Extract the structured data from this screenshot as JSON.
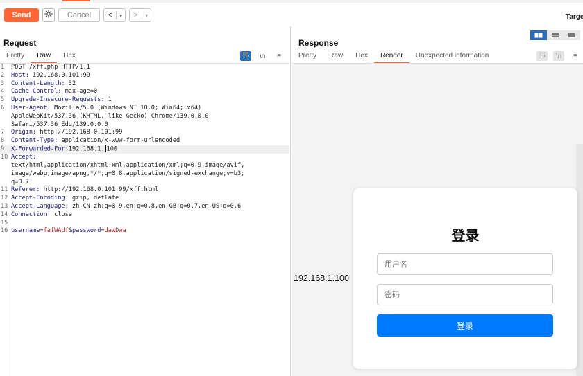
{
  "toolbar": {
    "send_label": "Send",
    "cancel_label": "Cancel",
    "back_arrow": "<",
    "back_dropdown": "▾",
    "forward_arrow": ">",
    "forward_dropdown": "▾",
    "target_label": "Targe",
    "send_color": "#ff6633"
  },
  "request": {
    "title": "Request",
    "tabs": [
      "Pretty",
      "Raw",
      "Hex"
    ],
    "active_tab": "Raw",
    "tool_newline": "\\n",
    "tool_menu": "≡",
    "lines": [
      {
        "n": "1",
        "text": "POST /xff.php HTTP/1.1"
      },
      {
        "n": "2",
        "key": "Host:",
        "val": " 192.168.0.101:99"
      },
      {
        "n": "3",
        "key": "Content-Length:",
        "val": " 32"
      },
      {
        "n": "4",
        "key": "Cache-Control:",
        "val": " max-age=0"
      },
      {
        "n": "5",
        "key": "Upgrade-Insecure-Requests:",
        "val": " 1"
      },
      {
        "n": "6",
        "key": "User-Agent:",
        "val": " Mozilla/5.0 (Windows NT 10.0; Win64; x64)"
      },
      {
        "n": "",
        "text": "AppleWebKit/537.36 (KHTML, like Gecko) Chrome/139.0.0.0"
      },
      {
        "n": "",
        "text": "Safari/537.36 Edg/139.0.0.0"
      },
      {
        "n": "7",
        "key": "Origin:",
        "val": " http://192.168.0.101:99"
      },
      {
        "n": "8",
        "key": "Content-Type:",
        "val": " application/x-www-form-urlencoded"
      },
      {
        "n": "9",
        "key": "X-Forwarded-For:",
        "val": "192.168.1.",
        "val2": "100",
        "caret": true,
        "highlight": true
      },
      {
        "n": "10",
        "key": "Accept:",
        "val": ""
      },
      {
        "n": "",
        "text": "text/html,application/xhtml+xml,application/xml;q=0.9,image/avif,"
      },
      {
        "n": "",
        "text": "image/webp,image/apng,*/*;q=0.8,application/signed-exchange;v=b3;"
      },
      {
        "n": "",
        "text": "q=0.7"
      },
      {
        "n": "11",
        "key": "Referer:",
        "val": " http://192.168.0.101:99/xff.html"
      },
      {
        "n": "12",
        "key": "Accept-Encoding:",
        "val": " gzip, deflate"
      },
      {
        "n": "13",
        "key": "Accept-Language:",
        "val": " zh-CN,zh;q=0.9,en;q=0.8,en-GB;q=0.7,en-US;q=0.6"
      },
      {
        "n": "14",
        "key": "Connection:",
        "val": " close"
      },
      {
        "n": "15",
        "text": ""
      },
      {
        "n": "16",
        "params": [
          {
            "name": "username",
            "value": "fafWAdf"
          },
          {
            "name": "password",
            "value": "dawDwa"
          }
        ]
      }
    ]
  },
  "response": {
    "title": "Response",
    "tabs": [
      "Pretty",
      "Raw",
      "Hex",
      "Render",
      "Unexpected information"
    ],
    "active_tab": "Render",
    "tool_newline": "\\n",
    "tool_menu": "≡",
    "rendered_ip": "192.168.1.100",
    "login": {
      "title": "登录",
      "username_placeholder": "用户名",
      "password_placeholder": "密码",
      "submit_label": "登录",
      "button_color": "#007bff"
    }
  }
}
